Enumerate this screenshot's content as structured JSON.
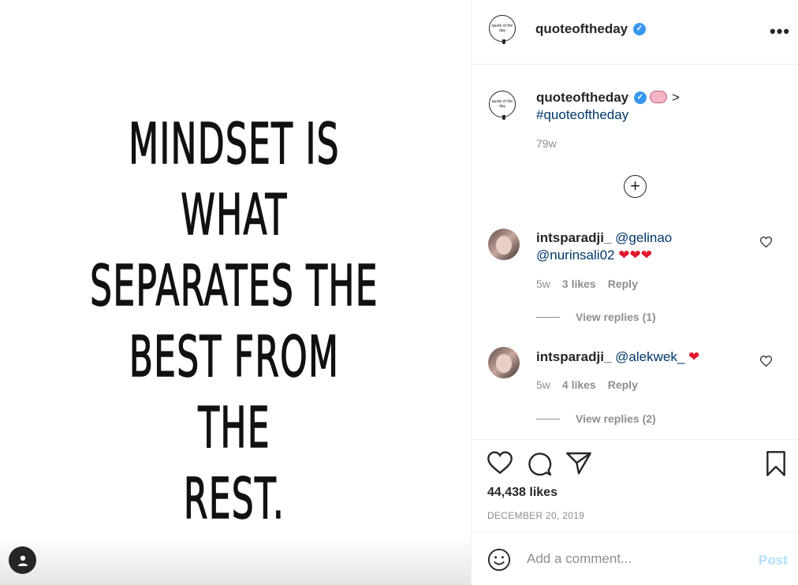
{
  "media": {
    "quote_lines": [
      "MINDSET IS",
      "WHAT",
      "SEPARATES THE",
      "BEST FROM THE",
      "REST."
    ],
    "user_tag_icon": "person-icon"
  },
  "header": {
    "logo_text": "quote of the day",
    "username": "quoteoftheday",
    "verified_icon": "verified-badge-icon",
    "more_label": "•••"
  },
  "caption": {
    "username": "quoteoftheday",
    "emoji": "brain-emoji",
    "arrow": ">",
    "hashtag": "#quoteoftheday",
    "time": "79w"
  },
  "load_more_icon": "plus-circle-icon",
  "comments": [
    {
      "username": "intsparadji_",
      "mentions": "@gelinao",
      "mentions2": "@nurinsali02",
      "hearts": "❤❤❤",
      "time": "5w",
      "likes": "3 likes",
      "reply": "Reply",
      "view_replies": "View replies (1)"
    },
    {
      "username": "intsparadji_",
      "mentions": "@alekwek_",
      "hearts": "❤",
      "time": "5w",
      "likes": "4 likes",
      "reply": "Reply",
      "view_replies": "View replies (2)"
    }
  ],
  "actions": {
    "like_icon": "heart-outline-icon",
    "comment_icon": "comment-bubble-icon",
    "share_icon": "paper-plane-icon",
    "save_icon": "bookmark-icon",
    "likes_count": "44,438 likes",
    "date": "DECEMBER 20, 2019"
  },
  "comment_box": {
    "emoji_icon": "smiley-icon",
    "placeholder": "Add a comment...",
    "post_label": "Post"
  },
  "colors": {
    "verified": "#3897f0",
    "link": "#00376b",
    "muted": "#8e8e8e",
    "post_disabled": "#b2dffc",
    "heart_red": "#e0182d"
  }
}
